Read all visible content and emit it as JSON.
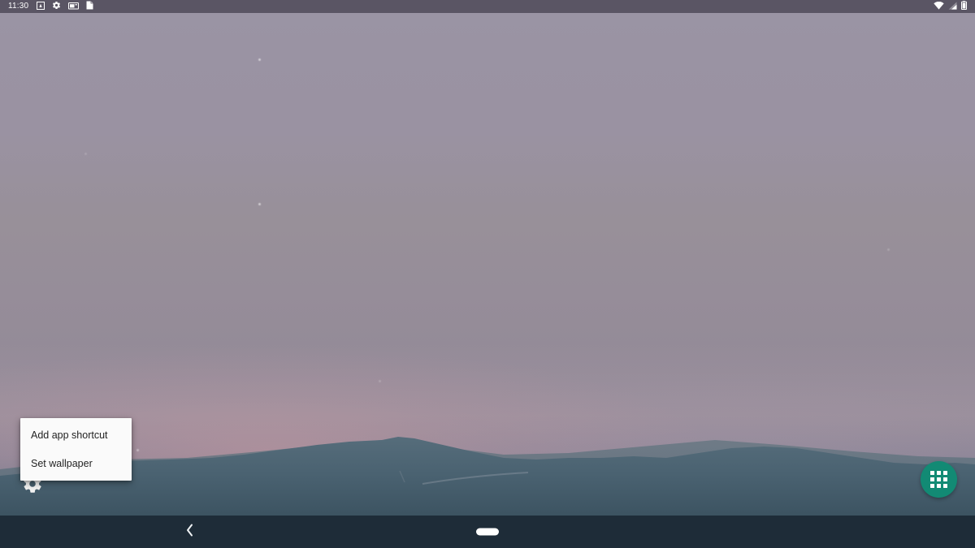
{
  "device": {
    "platform": "Android",
    "screen_name": "home-screen"
  },
  "status_bar": {
    "clock": "11:30",
    "background_color": "#5a5564",
    "text_color": "#ffffff",
    "left_icons": [
      {
        "name": "app-notification-icon",
        "glyph": "app"
      },
      {
        "name": "settings-notification-icon",
        "glyph": "gear"
      },
      {
        "name": "battery-saver-notification-icon",
        "glyph": "card"
      },
      {
        "name": "clipboard-notification-icon",
        "glyph": "clipboard"
      }
    ],
    "right_icons": [
      {
        "name": "wifi-icon",
        "glyph": "wifi"
      },
      {
        "name": "cell-signal-icon",
        "glyph": "signal"
      },
      {
        "name": "battery-icon",
        "glyph": "battery"
      }
    ]
  },
  "wallpaper": {
    "description": "Dusk mountain landscape",
    "sky_top_color": "#9a94a4",
    "sky_horizon_color": "#8b8495",
    "glow_color": "#c4949c",
    "mountain_color": "#4e6573",
    "foreground_color": "#3a4f5e"
  },
  "context_menu": {
    "visible": true,
    "background_color": "#fafafa",
    "text_color": "#232323",
    "items": [
      {
        "label": "Add app shortcut",
        "name": "menu-item-add-app-shortcut"
      },
      {
        "label": "Set wallpaper",
        "name": "menu-item-set-wallpaper"
      }
    ]
  },
  "desktop": {
    "shortcuts": [
      {
        "label": "Settings",
        "icon": "gear-icon",
        "name": "settings-shortcut"
      }
    ],
    "app_drawer": {
      "label": "All apps",
      "icon": "grid-icon",
      "background_color": "#128a74",
      "icon_color": "#ffffff"
    }
  },
  "nav_bar": {
    "background_color": "#1e2c38",
    "buttons": [
      {
        "label": "Back",
        "icon": "chevron-left-icon",
        "name": "nav-back-button"
      },
      {
        "label": "Home",
        "icon": "home-pill-icon",
        "name": "nav-home-button"
      }
    ]
  }
}
